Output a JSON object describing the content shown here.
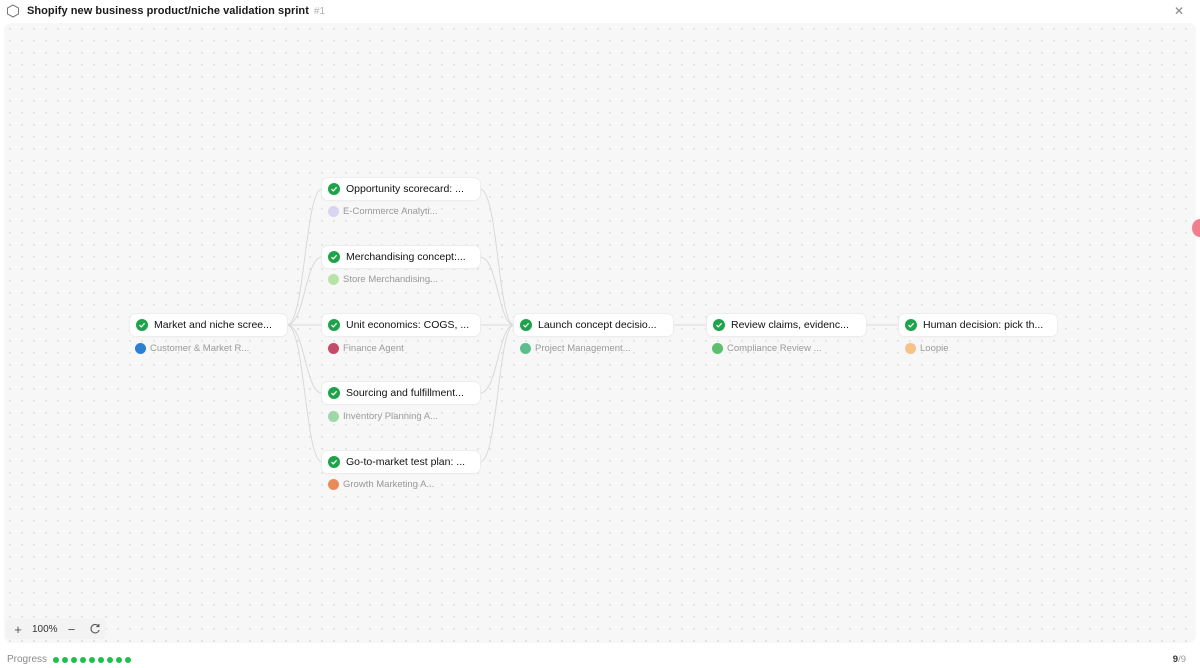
{
  "header": {
    "title": "Shopify new business product/niche validation sprint",
    "number": "#1"
  },
  "nodes": [
    {
      "id": "n1",
      "label": "Market and niche scree...",
      "agent": "Customer & Market R...",
      "agent_icon_color": "#2d7fd0"
    },
    {
      "id": "n2",
      "label": "Opportunity scorecard: ...",
      "agent": "E-Commerce Analyti...",
      "agent_icon_color": "#d9d4ef"
    },
    {
      "id": "n3",
      "label": "Merchandising concept:...",
      "agent": "Store Merchandising...",
      "agent_icon_color": "#b8e3a8"
    },
    {
      "id": "n4",
      "label": "Unit economics: COGS, ...",
      "agent": "Finance Agent",
      "agent_icon_color": "#c64b6a"
    },
    {
      "id": "n5",
      "label": "Sourcing and fulfillment...",
      "agent": "Inventory Planning A...",
      "agent_icon_color": "#9ed8a6"
    },
    {
      "id": "n6",
      "label": "Go-to-market test plan: ...",
      "agent": "Growth Marketing A...",
      "agent_icon_color": "#e98a5a"
    },
    {
      "id": "n7",
      "label": "Launch concept decisio...",
      "agent": "Project Management...",
      "agent_icon_color": "#5bc08d"
    },
    {
      "id": "n8",
      "label": "Review claims, evidenc...",
      "agent": "Compliance Review ...",
      "agent_icon_color": "#5bbf6b"
    },
    {
      "id": "n9",
      "label": "Human decision: pick th...",
      "agent": "Loopie",
      "agent_icon_color": "#f5c28a"
    }
  ],
  "zoom": {
    "plus": "+",
    "level": "100%",
    "minus": "−"
  },
  "footer": {
    "progress_label": "Progress",
    "completed": "9",
    "total": "/9",
    "completed_fraction": 1.0
  },
  "colors": {
    "status_complete": "#1fa34a",
    "progress_dot": "#1fbf4c"
  }
}
